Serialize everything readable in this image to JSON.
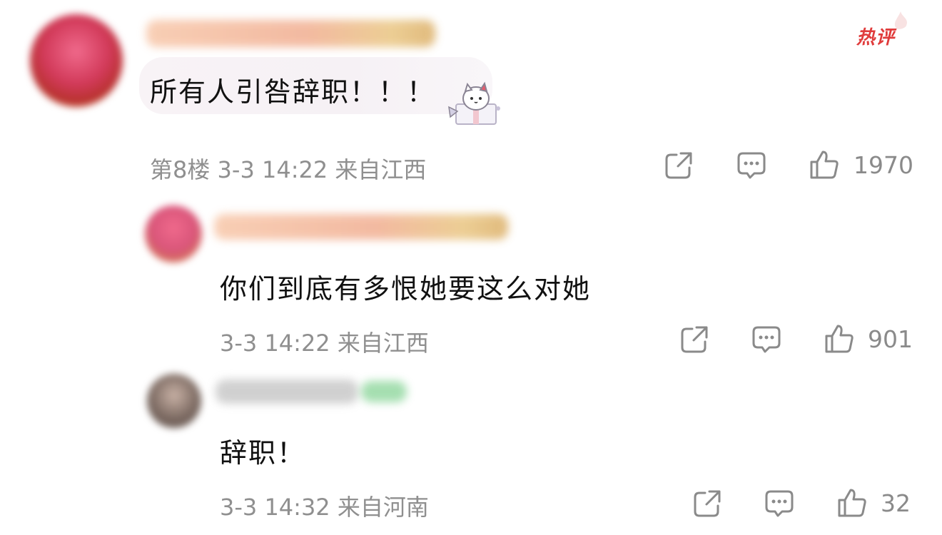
{
  "badge": {
    "label": "热评"
  },
  "comments": [
    {
      "text": "所有人引咎辞职！！！",
      "meta": "第8楼  3-3 14:22  来自江西",
      "likes": "1970"
    },
    {
      "text": "你们到底有多恨她要这么对她",
      "meta": "3-3 14:22  来自江西",
      "likes": "901"
    },
    {
      "text": "辞职！",
      "meta": "3-3 14:32  来自河南",
      "likes": "32"
    }
  ],
  "icons": {
    "share": "share-icon",
    "reply": "comment-icon",
    "like": "thumbs-up-icon",
    "decoration": "cat-gift-sticker"
  },
  "colors": {
    "badge": "#e03b3b",
    "meta": "#8f8f8f",
    "text": "#111111"
  }
}
